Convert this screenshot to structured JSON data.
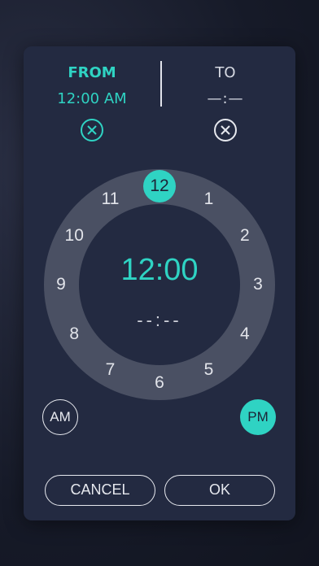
{
  "from": {
    "label": "FROM",
    "value": "12:00 AM"
  },
  "to": {
    "label": "TO",
    "value": "—:—"
  },
  "clock": {
    "hours": [
      "12",
      "1",
      "2",
      "3",
      "4",
      "5",
      "6",
      "7",
      "8",
      "9",
      "10",
      "11"
    ],
    "selected_hour": "12",
    "main_time": "12:00",
    "sub_time": "--:--"
  },
  "period": {
    "am_label": "AM",
    "pm_label": "PM",
    "selected": "PM"
  },
  "actions": {
    "cancel_label": "CANCEL",
    "ok_label": "OK"
  },
  "colors": {
    "accent": "#2fd3c3",
    "dialog": "#232a41",
    "ring": "#4a5063"
  },
  "icons": {
    "clear_from": "clear-circle-x-icon",
    "clear_to": "clear-circle-x-icon"
  }
}
